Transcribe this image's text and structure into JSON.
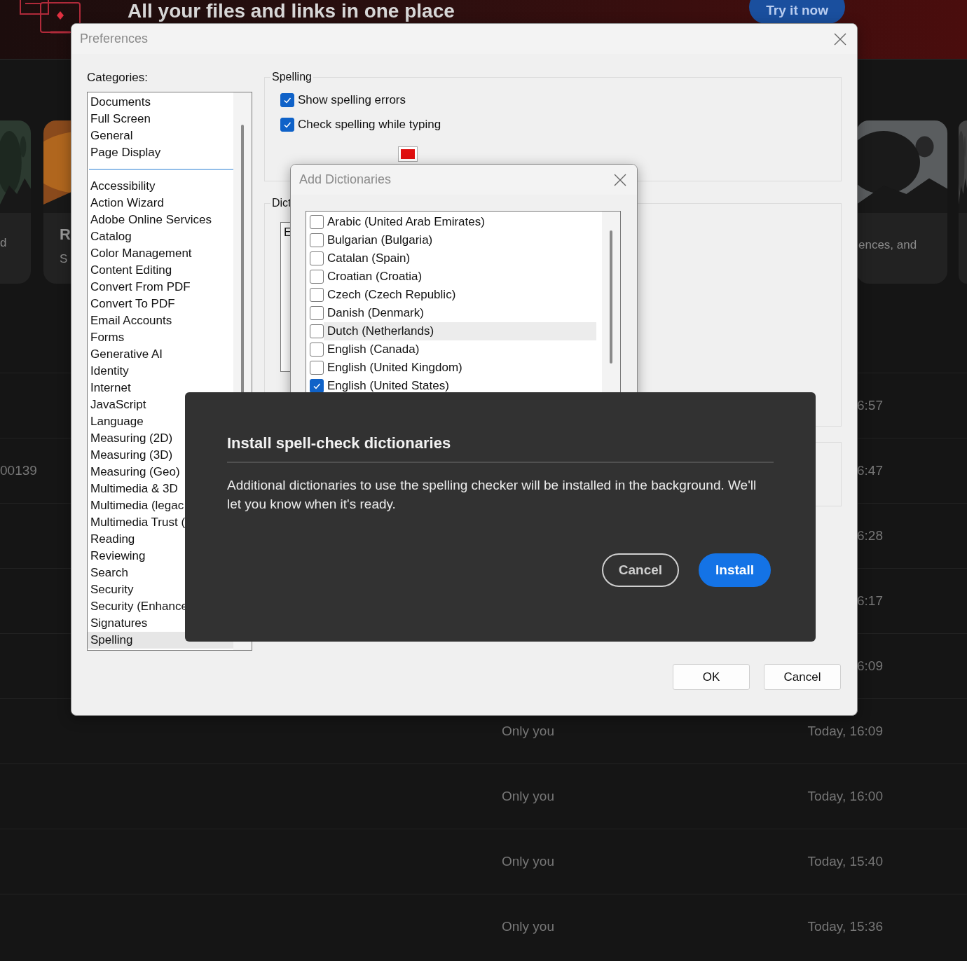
{
  "banner": {
    "title": "All your files and links in one place",
    "button": "Try it now"
  },
  "cards": [
    {
      "caption": "d"
    },
    {
      "title": "R",
      "caption": "S"
    },
    {
      "caption": "ences, and"
    }
  ],
  "rows": [
    {
      "time": "6:57"
    },
    {
      "name": "00139",
      "time": "6:47"
    },
    {
      "time": "6:28"
    },
    {
      "time": "6:17"
    },
    {
      "time": "6:09"
    },
    {
      "owner": "Only you",
      "time": "Today, 16:09"
    },
    {
      "owner": "Only you",
      "time": "Today, 16:00"
    },
    {
      "owner": "Only you",
      "time": "Today, 15:40"
    },
    {
      "owner": "Only you",
      "time": "Today, 15:36"
    }
  ],
  "preferences": {
    "title": "Preferences",
    "categories_label": "Categories:",
    "category_groups": [
      {
        "items": [
          {
            "label": "Documents",
            "selected": false
          },
          {
            "label": "Full Screen",
            "selected": false
          },
          {
            "label": "General",
            "selected": false
          },
          {
            "label": "Page Display",
            "selected": false
          }
        ]
      },
      {
        "items": [
          {
            "label": "Accessibility",
            "selected": false
          },
          {
            "label": "Action Wizard",
            "selected": false
          },
          {
            "label": "Adobe Online Services",
            "selected": false
          },
          {
            "label": "Catalog",
            "selected": false
          },
          {
            "label": "Color Management",
            "selected": false
          },
          {
            "label": "Content Editing",
            "selected": false
          },
          {
            "label": "Convert From PDF",
            "selected": false
          },
          {
            "label": "Convert To PDF",
            "selected": false
          },
          {
            "label": "Email Accounts",
            "selected": false
          },
          {
            "label": "Forms",
            "selected": false
          },
          {
            "label": "Generative AI",
            "selected": false
          },
          {
            "label": "Identity",
            "selected": false
          },
          {
            "label": "Internet",
            "selected": false
          },
          {
            "label": "JavaScript",
            "selected": false
          },
          {
            "label": "Language",
            "selected": false
          },
          {
            "label": "Measuring (2D)",
            "selected": false
          },
          {
            "label": "Measuring (3D)",
            "selected": false
          },
          {
            "label": "Measuring (Geo)",
            "selected": false
          },
          {
            "label": "Multimedia & 3D",
            "selected": false
          },
          {
            "label": "Multimedia (legac",
            "selected": false
          },
          {
            "label": "Multimedia Trust (",
            "selected": false
          },
          {
            "label": "Reading",
            "selected": false
          },
          {
            "label": "Reviewing",
            "selected": false
          },
          {
            "label": "Search",
            "selected": false
          },
          {
            "label": "Security",
            "selected": false
          },
          {
            "label": "Security (Enhance",
            "selected": false
          },
          {
            "label": "Signatures",
            "selected": false
          },
          {
            "label": "Spelling",
            "selected": true
          }
        ]
      }
    ],
    "spelling": {
      "legend": "Spelling",
      "options": [
        {
          "label": "Show spelling errors",
          "checked": true
        },
        {
          "label": "Check spelling while typing",
          "checked": true
        }
      ]
    },
    "dictionaries": {
      "legend": "Dict",
      "list_text": "E"
    },
    "buttons": [
      "OK",
      "Cancel"
    ]
  },
  "add_dictionaries": {
    "title": "Add Dictionaries",
    "languages": [
      {
        "label": "Arabic (United Arab Emirates)",
        "checked": false,
        "highlighted": false
      },
      {
        "label": "Bulgarian (Bulgaria)",
        "checked": false,
        "highlighted": false
      },
      {
        "label": "Catalan (Spain)",
        "checked": false,
        "highlighted": false
      },
      {
        "label": "Croatian (Croatia)",
        "checked": false,
        "highlighted": false
      },
      {
        "label": "Czech (Czech Republic)",
        "checked": false,
        "highlighted": false
      },
      {
        "label": "Danish (Denmark)",
        "checked": false,
        "highlighted": false
      },
      {
        "label": "Dutch (Netherlands)",
        "checked": false,
        "highlighted": true
      },
      {
        "label": "English (Canada)",
        "checked": false,
        "highlighted": false
      },
      {
        "label": "English (United Kingdom)",
        "checked": false,
        "highlighted": false
      },
      {
        "label": "English (United States)",
        "checked": true,
        "highlighted": false
      }
    ]
  },
  "install_dialog": {
    "title": "Install spell-check dictionaries",
    "message": "Additional dictionaries to use the spelling checker will be installed in the background. We'll let you know when it's ready.",
    "buttons": [
      {
        "label": "Cancel",
        "kind": "secondary"
      },
      {
        "label": "Install",
        "kind": "primary"
      }
    ]
  }
}
